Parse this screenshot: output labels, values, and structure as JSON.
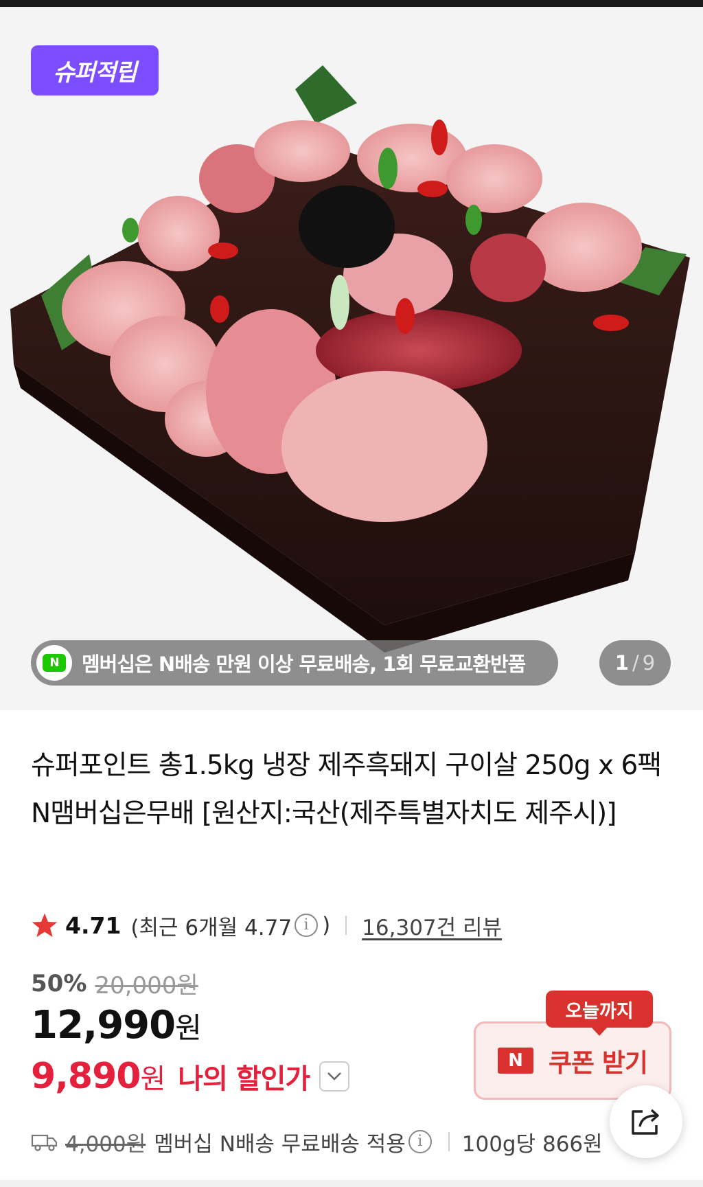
{
  "hero": {
    "badge": "슈퍼적립",
    "shipping_notice": "멤버십은 N배송 만원 이상 무료배송, 1회 무료교환반품",
    "page_current": "1",
    "page_total": "9",
    "image_icon": "meat-platter-photo"
  },
  "product": {
    "title": "슈퍼포인트 총1.5kg 냉장 제주흑돼지 구이살 250g x 6팩 N맴버십은무배 [원산지:국산(제주특별자치도 제주시)]"
  },
  "rating": {
    "score": "4.71",
    "recent_prefix": "(최근 6개월 4.77",
    "recent_suffix": ")",
    "review_count": "16,307건 리뷰"
  },
  "price": {
    "discount_rate": "50%",
    "original": "20,000원",
    "sale": "12,990",
    "sale_unit": "원",
    "my_price": "9,890",
    "my_price_unit": "원",
    "my_price_label": "나의 할인가"
  },
  "coupon": {
    "tag": "오늘까지",
    "label": "쿠폰 받기",
    "n_mark": "N"
  },
  "delivery": {
    "original_fee": "4,000원",
    "notice": "멤버십 N배송 무료배송 적용",
    "unit_price": "100g당 866원"
  },
  "colors": {
    "badge_purple": "#7b4dff",
    "accent_red": "#e5203d",
    "coupon_red": "#d9312d",
    "star": "#e53935"
  },
  "icons": {
    "info": "ⓘ",
    "star": "star-icon",
    "truck": "truck-icon",
    "share": "share-icon",
    "chevron": "chevron-down-icon"
  }
}
